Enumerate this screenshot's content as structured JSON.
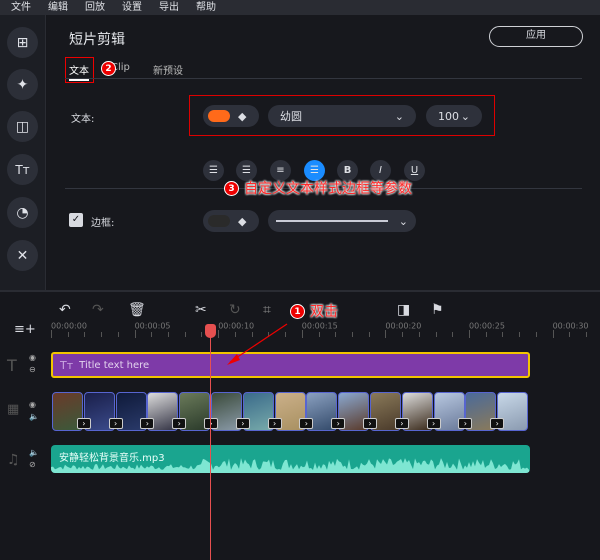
{
  "menu": [
    "文件",
    "编辑",
    "回放",
    "设置",
    "导出",
    "帮助"
  ],
  "sidebar": [
    {
      "icon": "add-media-icon"
    },
    {
      "icon": "magic-wand-icon"
    },
    {
      "icon": "transition-icon"
    },
    {
      "icon": "titles-icon"
    },
    {
      "icon": "filters-icon"
    },
    {
      "icon": "tools-icon"
    }
  ],
  "panel": {
    "title": "短片剪辑",
    "apply": "应用",
    "tabs": [
      "文本",
      "Clip",
      "新预设"
    ],
    "active_tab": "文本",
    "text_label": "文本:",
    "text_color": "#ff6a1a",
    "font": "幼圆",
    "size": "100",
    "align_buttons": [
      "align-left",
      "align-right",
      "justify",
      "align-center",
      "bold",
      "italic",
      "underline"
    ],
    "active_align": "align-center",
    "border_label": "边框:",
    "border_checked": true,
    "border_color": "#2a2a2a"
  },
  "annotations": {
    "a1_num": "1",
    "a1": "双击",
    "a2_num": "2",
    "a3_num": "3",
    "a3": "自定义文本样式边框等参数"
  },
  "timeline": {
    "ticks": [
      "00:00:00",
      "00:00:05",
      "00:00:10",
      "00:00:15",
      "00:00:20",
      "00:00:25",
      "00:00:30"
    ],
    "title_clip": "Title text here",
    "audio_clip": "安静轻松背景音乐.mp3",
    "playhead": "00:00:08",
    "thumb_count": 15
  }
}
